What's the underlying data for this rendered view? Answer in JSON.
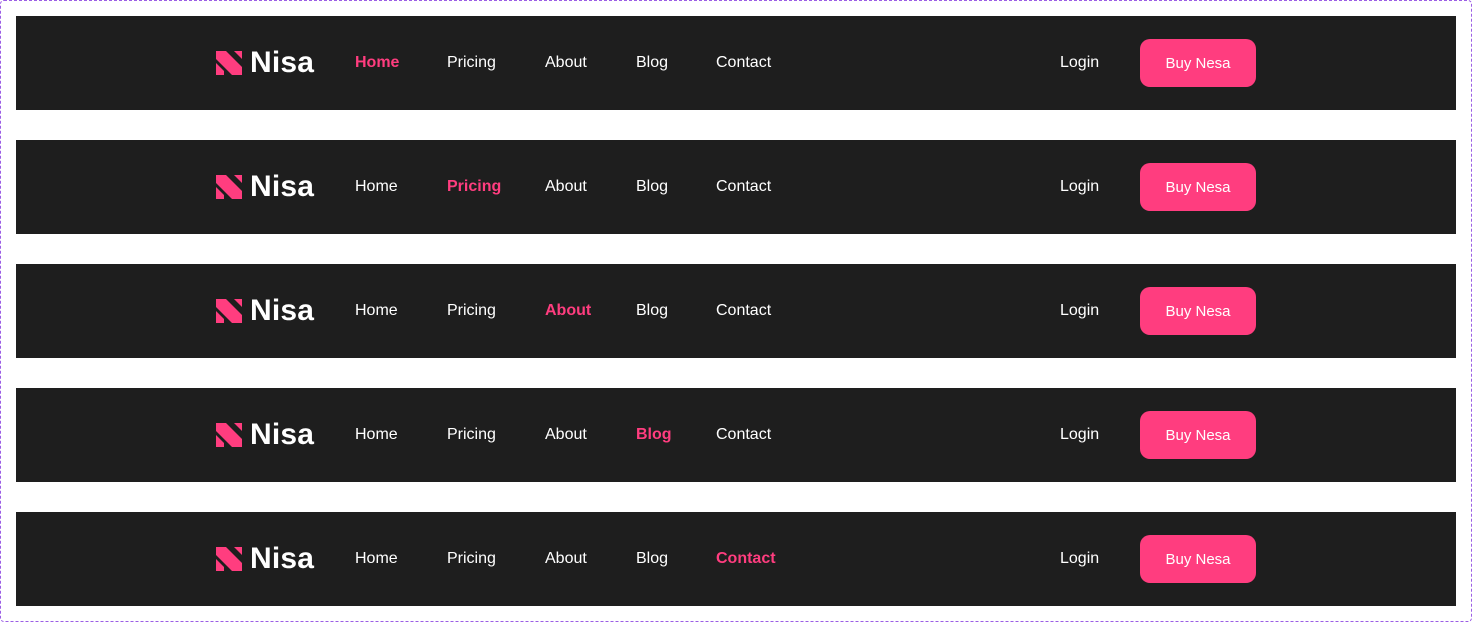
{
  "brand": {
    "name": "Nisa",
    "accent_color": "#ff3d7f",
    "logo_icon": "n-logo-icon"
  },
  "nav_links": [
    "Home",
    "Pricing",
    "About",
    "Blog",
    "Contact"
  ],
  "login_label": "Login",
  "cta_label": "Buy Nesa",
  "navbars": [
    {
      "active": "Home"
    },
    {
      "active": "Pricing"
    },
    {
      "active": "About"
    },
    {
      "active": "Blog"
    },
    {
      "active": "Contact"
    }
  ]
}
